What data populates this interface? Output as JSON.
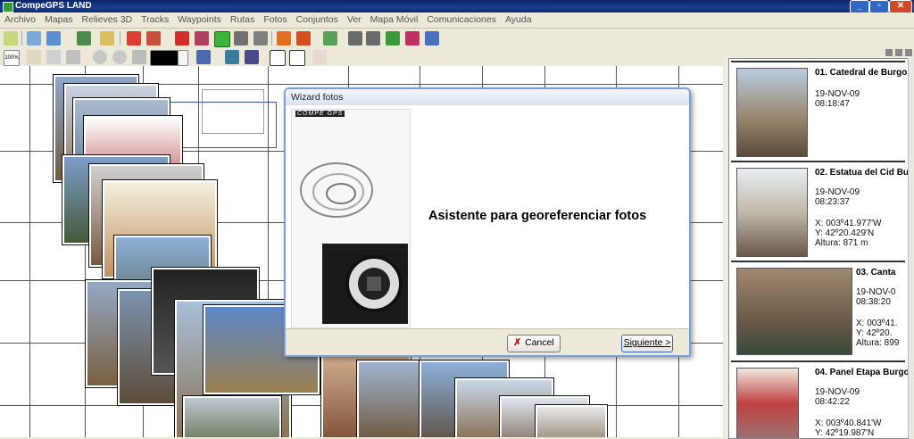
{
  "window": {
    "title": "CompeGPS LAND"
  },
  "menu": [
    "Archivo",
    "Mapas",
    "Relieves 3D",
    "Tracks",
    "Waypoints",
    "Rutas",
    "Fotos",
    "Conjuntos",
    "Ver",
    "Mapa Móvil",
    "Comunicaciones",
    "Ayuda"
  ],
  "toolbar": {
    "zoom_label": "100%"
  },
  "dialog": {
    "title": "Wizard fotos",
    "brand": "COMPE GPS",
    "heading": "Asistente para georeferenciar fotos",
    "cancel_label": "Cancel",
    "next_label": "Siguiente >"
  },
  "photos": [
    {
      "title": "01. Catedral de Burgo",
      "date": "19-NOV-09",
      "time": "08:18:47",
      "x": "",
      "y": "",
      "alt": ""
    },
    {
      "title": "02. Estatua del Cid Bu",
      "date": "19-NOV-09",
      "time": "08:23:37",
      "x": "X: 003º41.977'W",
      "y": "Y: 42º20.429'N",
      "alt": "Altura: 871 m"
    },
    {
      "title": "03. Canta",
      "date": "19-NOV-0",
      "time": "08:38:20",
      "x": "X: 003º41.",
      "y": "Y: 42º20.",
      "alt": "Altura: 899"
    },
    {
      "title": "04. Panel Etapa Burgo",
      "date": "19-NOV-09",
      "time": "08:42:22",
      "x": "X: 003º40.841'W",
      "y": "Y: 42º19.987'N",
      "alt": ""
    }
  ]
}
